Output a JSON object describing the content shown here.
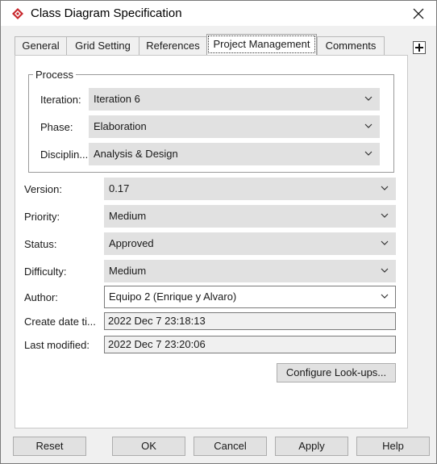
{
  "window": {
    "title": "Class Diagram Specification"
  },
  "tabs": [
    "General",
    "Grid Setting",
    "References",
    "Project Management",
    "Comments"
  ],
  "process": {
    "title": "Process",
    "iteration": {
      "label": "Iteration:",
      "value": "Iteration 6"
    },
    "phase": {
      "label": "Phase:",
      "value": "Elaboration"
    },
    "discipline": {
      "label": "Disciplin...",
      "value": "Analysis & Design"
    }
  },
  "fields": {
    "version": {
      "label": "Version:",
      "value": "0.17"
    },
    "priority": {
      "label": "Priority:",
      "value": "Medium"
    },
    "status": {
      "label": "Status:",
      "value": "Approved"
    },
    "difficulty": {
      "label": "Difficulty:",
      "value": "Medium"
    },
    "author": {
      "label": "Author:",
      "value": "Equipo 2 (Enrique y Alvaro)"
    },
    "create_date": {
      "label": "Create date ti...",
      "value": "2022 Dec 7 23:18:13"
    },
    "last_modified": {
      "label": "Last modified:",
      "value": "2022 Dec 7 23:20:06"
    }
  },
  "configure_label": "Configure Look-ups...",
  "buttons": {
    "reset": "Reset",
    "ok": "OK",
    "cancel": "Cancel",
    "apply": "Apply",
    "help": "Help"
  },
  "colors": {
    "app_icon": "#c8282d",
    "panel": "#ffffff",
    "combo": "#e1e1e1"
  },
  "icons": {
    "app": "app-logo-icon",
    "close": "close-icon",
    "add_tab": "plus-icon",
    "dropdown": "chevron-down-icon"
  }
}
